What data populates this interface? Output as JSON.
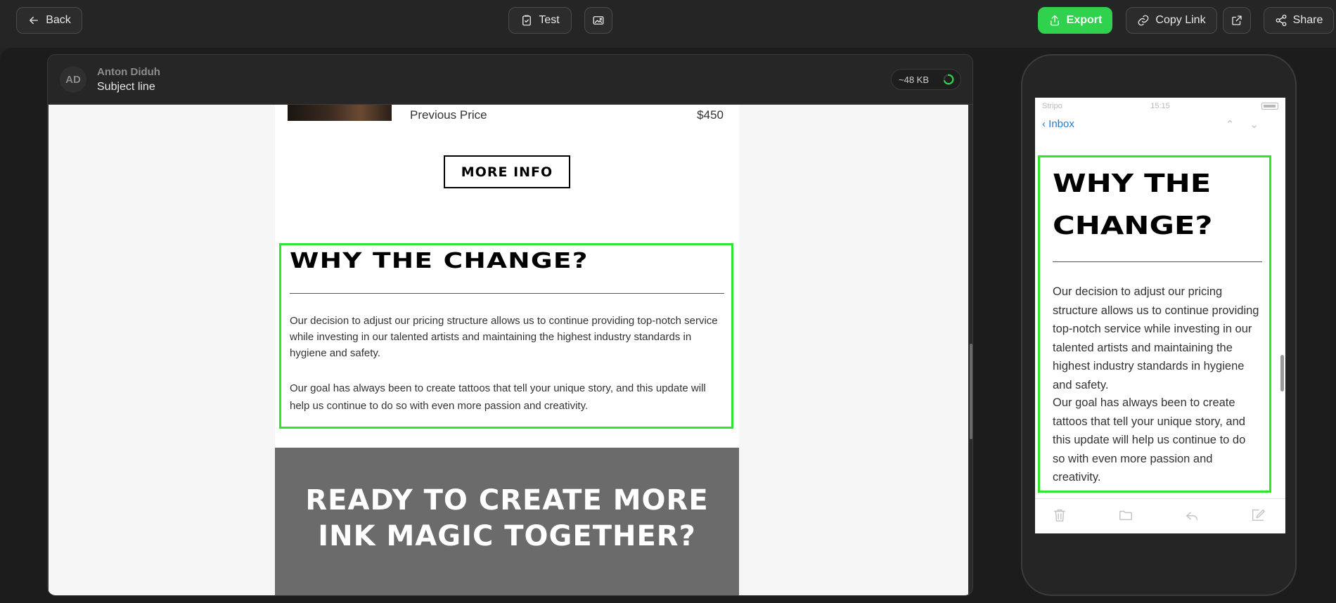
{
  "toolbar": {
    "back_label": "Back",
    "test_label": "Test",
    "export_label": "Export",
    "copy_link_label": "Copy Link",
    "share_label": "Share"
  },
  "editor": {
    "avatar_initials": "AD",
    "sender_name": "Anton Diduh",
    "subject_line": "Subject line",
    "size_badge": "~48 KB"
  },
  "email": {
    "previous_price_label": "Previous Price",
    "previous_price_value": "$450",
    "more_info_button": "MORE INFO",
    "why_title": "WHY THE CHANGE?",
    "why_paragraph_1": "Our decision to adjust our pricing structure allows us to continue providing top-notch service while investing in our talented artists and maintaining the highest industry standards in hygiene and safety.",
    "why_paragraph_2": "Our goal has always been to create tattoos that tell your unique story, and this update will help us continue to do so with even more passion and creativity.",
    "ready_title": "READY TO CREATE MORE INK MAGIC TOGETHER?"
  },
  "mobile": {
    "carrier": "Stripo",
    "time": "15:15",
    "inbox_label": "Inbox",
    "why_title": "WHY THE\nCHANGE?",
    "why_paragraph_1": "Our decision to adjust our pricing structure allows us to continue providing top-notch service while investing in our talented artists and maintaining the highest industry standards in hygiene and safety.",
    "why_paragraph_2": "Our goal has always been to create tattoos that tell your unique story, and this update will help us continue to do so with even more passion and creativity."
  },
  "colors": {
    "accent_green": "#2fd14d",
    "selection_outline": "#2ee62e",
    "link_blue": "#1f7ad6"
  }
}
